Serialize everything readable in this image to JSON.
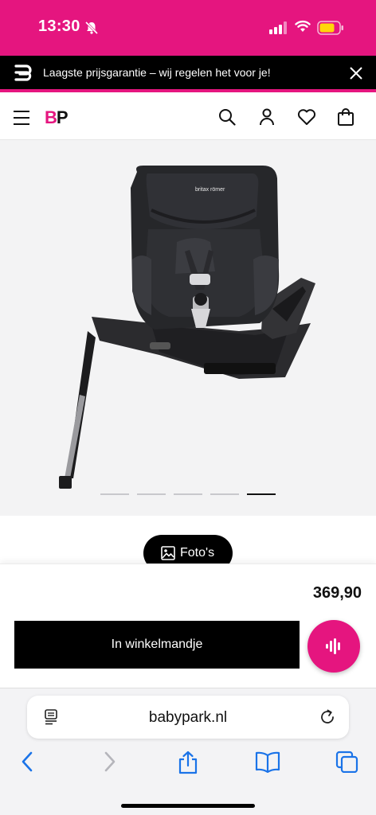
{
  "status_bar": {
    "time": "13:30",
    "icons": [
      "bell-slash-icon",
      "signal-icon",
      "wifi-icon",
      "battery-icon"
    ]
  },
  "promo": {
    "text": "Laagste prijsgarantie – wij regelen het voor je!",
    "icons": [
      "brand-mark-icon",
      "close-icon"
    ]
  },
  "header": {
    "logo_b": "B",
    "logo_p": "P",
    "icons": [
      "menu-icon",
      "search-icon",
      "account-icon",
      "heart-icon",
      "bag-icon"
    ]
  },
  "gallery": {
    "image_label": "britax römer",
    "slide_count": 5,
    "active_slide": 5
  },
  "photos_button": {
    "label": "Foto's",
    "icon": "image-icon"
  },
  "product": {
    "price": "369,90",
    "add_to_cart_label": "In winkelmandje"
  },
  "fab": {
    "icon": "voice-assistant-icon"
  },
  "browser": {
    "url": "babypark.nl",
    "toolbar_icons": [
      "back-icon",
      "forward-icon",
      "share-icon",
      "bookmarks-icon",
      "tabs-icon"
    ]
  },
  "colors": {
    "brand_pink": "#e5157f",
    "black": "#000000",
    "gallery_bg": "#f3f3f4"
  }
}
